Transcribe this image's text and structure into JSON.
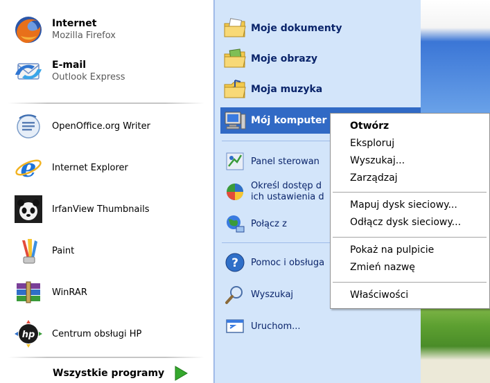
{
  "left_pane": {
    "pinned": [
      {
        "title": "Internet",
        "subtitle": "Mozilla Firefox",
        "icon": "firefox-icon"
      },
      {
        "title": "E-mail",
        "subtitle": "Outlook Express",
        "icon": "outlook-express-icon"
      }
    ],
    "recent": [
      {
        "label": "OpenOffice.org Writer",
        "icon": "openoffice-writer-icon"
      },
      {
        "label": "Internet Explorer",
        "icon": "internet-explorer-icon"
      },
      {
        "label": "IrfanView Thumbnails",
        "icon": "irfanview-icon"
      },
      {
        "label": "Paint",
        "icon": "paint-icon"
      },
      {
        "label": "WinRAR",
        "icon": "winrar-icon"
      },
      {
        "label": "Centrum obsługi HP",
        "icon": "hp-icon"
      }
    ],
    "all_programs_label": "Wszystkie programy"
  },
  "right_pane": {
    "places": [
      {
        "label": "Moje dokumenty",
        "icon": "my-documents-folder-icon"
      },
      {
        "label": "Moje obrazy",
        "icon": "my-pictures-folder-icon"
      },
      {
        "label": "Moja muzyka",
        "icon": "my-music-folder-icon"
      },
      {
        "label": "Mój komputer",
        "icon": "my-computer-icon"
      }
    ],
    "settings": [
      {
        "label": "Panel sterowan",
        "icon": "control-panel-icon"
      },
      {
        "label_line1": "Określ dostęp d",
        "label_line2": "ich ustawienia d",
        "icon": "program-access-icon"
      },
      {
        "label": "Połącz z",
        "icon": "connect-to-icon"
      }
    ],
    "tools": [
      {
        "label": "Pomoc i obsługa",
        "icon": "help-icon"
      },
      {
        "label": "Wyszukaj",
        "icon": "search-icon"
      },
      {
        "label": "Uruchom...",
        "icon": "run-icon"
      }
    ]
  },
  "context_menu": {
    "groups": [
      [
        "Otwórz",
        "Eksploruj",
        "Wyszukaj...",
        "Zarządzaj"
      ],
      [
        "Mapuj dysk sieciowy...",
        "Odłącz dysk sieciowy..."
      ],
      [
        "Pokaż na pulpicie",
        "Zmień nazwę"
      ],
      [
        "Właściwości"
      ]
    ]
  },
  "colors": {
    "right_pane_bg": "#d3e5fa",
    "selection_bg": "#316ac5",
    "link_text": "#0a246a"
  }
}
